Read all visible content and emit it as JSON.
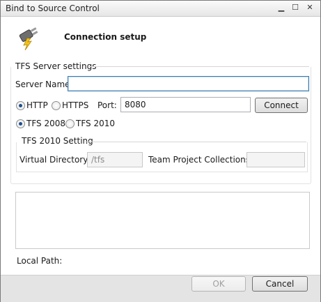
{
  "window": {
    "title": "Bind to Source Control",
    "controls": {
      "minimize": "▁",
      "maximize": "☐",
      "close": "✕"
    }
  },
  "header": {
    "icon": "plug-lightning-icon",
    "title": "Connection setup"
  },
  "tfs_group": {
    "label": "TFS Server settings",
    "server_name_label": "Server Name:",
    "server_name_value": "",
    "protocols": [
      {
        "label": "HTTP",
        "checked": true
      },
      {
        "label": "HTTPS",
        "checked": false
      }
    ],
    "port_label": "Port:",
    "port_value": "8080",
    "connect_label": "Connect",
    "versions": [
      {
        "label": "TFS 2008",
        "checked": true
      },
      {
        "label": "TFS 2010",
        "checked": false
      }
    ],
    "tfs2010": {
      "label": "TFS 2010 Setting",
      "virtual_dir_label": "Virtual Directory:",
      "virtual_dir_value": "/tfs",
      "collections_label": "Team Project Collections:",
      "collections_value": ""
    }
  },
  "local_path_label": "Local Path:",
  "footer": {
    "ok_label": "OK",
    "cancel_label": "Cancel"
  },
  "colors": {
    "accent": "#1d4f8a",
    "footer_bg": "#e4e4e4"
  }
}
